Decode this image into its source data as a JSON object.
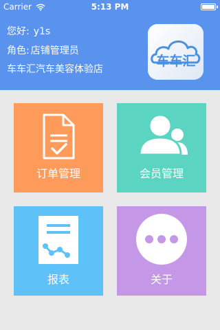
{
  "status_bar": {
    "carrier": "Carrier",
    "time": "5:13 PM",
    "wifi_icon": "wifi-icon",
    "battery_icon": "battery-icon",
    "battery_level": 0.95
  },
  "header": {
    "greeting_label": "您好:",
    "username": "y1s",
    "role_label": "角色:",
    "role": "店铺管理员",
    "store_name": "车车汇汽车美容体验店",
    "logo_text": "车车汇",
    "background": "#5a93ee"
  },
  "tiles": [
    {
      "label": "订单管理",
      "icon": "document-check-icon",
      "color": "#fe9b5a"
    },
    {
      "label": "会员管理",
      "icon": "users-icon",
      "color": "#5bd5c2"
    },
    {
      "label": "报表",
      "icon": "report-chart-icon",
      "color": "#5ec1f8"
    },
    {
      "label": "关于",
      "icon": "more-dots-icon",
      "color": "#c597e7"
    }
  ]
}
